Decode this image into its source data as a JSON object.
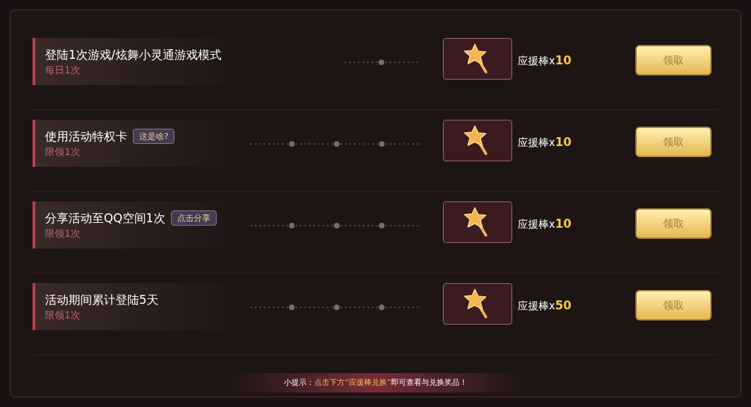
{
  "tasks": [
    {
      "title": "登陆1次游戏/炫舞小灵通游戏模式",
      "limit": "每日1次",
      "kind": "single",
      "reward_label": "应援棒x",
      "reward_count": "10",
      "button": "领取"
    },
    {
      "title": "使用活动特权卡",
      "tag": "这是啥?",
      "limit": "限领1次",
      "kind": "triple",
      "reward_label": "应援棒x",
      "reward_count": "10",
      "button": "领取"
    },
    {
      "title": "分享活动至QQ空间1次",
      "tag": "点击分享",
      "limit": "限领1次",
      "kind": "triple",
      "reward_label": "应援棒x",
      "reward_count": "10",
      "button": "领取"
    },
    {
      "title": "活动期间累计登陆5天",
      "limit": "限领1次",
      "kind": "triple",
      "reward_label": "应援棒x",
      "reward_count": "50",
      "button": "领取"
    }
  ],
  "hint": [
    {
      "text": "小提示：",
      "highlight": false
    },
    {
      "text": "点击下方“应援棒兑换”",
      "highlight": true
    },
    {
      "text": "即可查看与兑换奖品！",
      "highlight": false
    }
  ]
}
